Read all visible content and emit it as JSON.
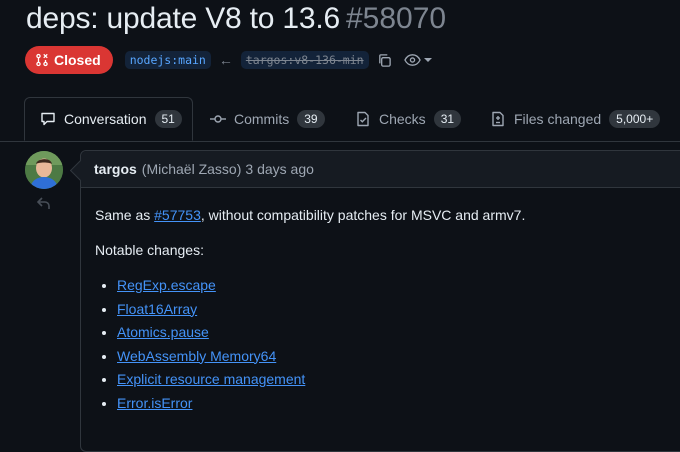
{
  "pr": {
    "title": "deps: update V8 to 13.6",
    "number": "#58070",
    "state": "Closed",
    "base_branch": "nodejs:main",
    "head_branch": "targos:v8-136-min"
  },
  "tabs": [
    {
      "label": "Conversation",
      "count": "51",
      "icon": "comment-icon"
    },
    {
      "label": "Commits",
      "count": "39",
      "icon": "commit-icon"
    },
    {
      "label": "Checks",
      "count": "31",
      "icon": "checklist-icon"
    },
    {
      "label": "Files changed",
      "count": "5,000+",
      "icon": "file-diff-icon"
    }
  ],
  "comment": {
    "author": "targos",
    "author_fullname": "(Michaël Zasso)",
    "time": "3 days ago",
    "intro_prefix": "Same as ",
    "intro_link": "#57753",
    "intro_suffix": ", without compatibility patches for MSVC and armv7.",
    "notable_heading": "Notable changes:",
    "changes": [
      "RegExp.escape",
      "Float16Array",
      "Atomics.pause",
      "WebAssembly Memory64",
      "Explicit resource management",
      "Error.isError"
    ]
  },
  "colors": {
    "background": "#0d1117",
    "closed": "#da3633",
    "link": "#4493f8"
  }
}
